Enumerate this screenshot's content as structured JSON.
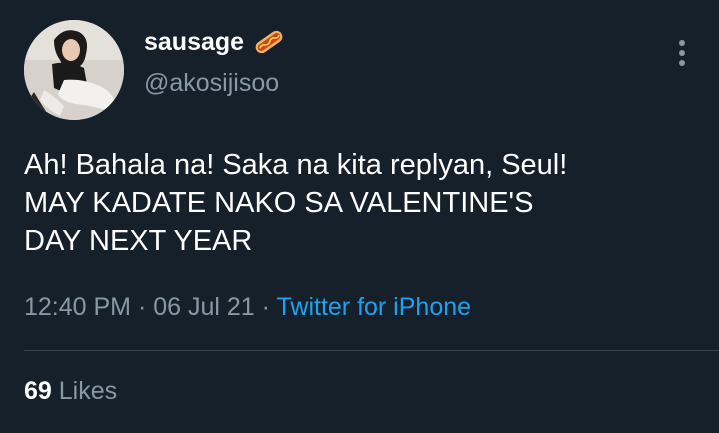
{
  "user": {
    "display_name": "sausage",
    "name_emoji": "hotdog-emoji",
    "handle": "@akosijisoo"
  },
  "tweet": {
    "text": "Ah! Bahala na! Saka na kita replyan, Seul!\nMAY KADATE NAKO SA VALENTINE'S\nDAY NEXT YEAR",
    "time": "12:40 PM",
    "date": "06 Jul 21",
    "source": "Twitter for iPhone",
    "separator": "·"
  },
  "stats": {
    "likes_count": "69",
    "likes_label": "Likes"
  },
  "icons": {
    "more": "more-vertical-icon"
  },
  "colors": {
    "background": "#15202b",
    "secondary_text": "#8899a6",
    "link": "#1da1f2",
    "divider": "#38444d"
  }
}
